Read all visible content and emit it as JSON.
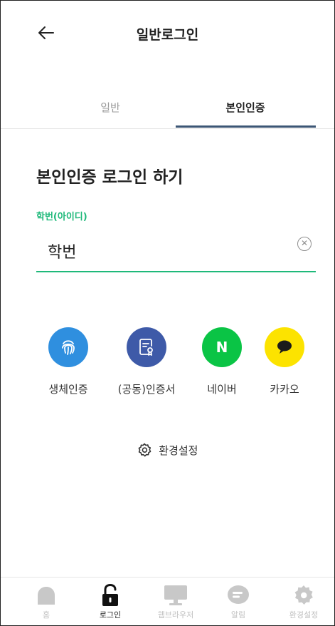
{
  "header": {
    "title": "일반로그인",
    "back_icon": "arrow-left-icon"
  },
  "tabs": [
    {
      "label": "일반",
      "active": false
    },
    {
      "label": "본인인증",
      "active": true
    }
  ],
  "section_title": "본인인증 로그인 하기",
  "student_field": {
    "label": "학번(아이디)",
    "value": "학번",
    "clear_icon": "clear-circle-icon"
  },
  "methods": [
    {
      "label": "생체인증",
      "icon": "fingerprint-icon",
      "color": "#2f8fdf"
    },
    {
      "label": "(공동)인증서",
      "icon": "certificate-icon",
      "color": "#3e5aa8"
    },
    {
      "label": "네이버",
      "icon": "naver-icon",
      "glyph": "N",
      "color": "#0ac445"
    },
    {
      "label": "카카오",
      "icon": "kakao-icon",
      "color": "#fce300"
    }
  ],
  "settings_link": {
    "label": "환경설정",
    "icon": "gear-icon"
  },
  "bottom_nav": [
    {
      "label": "홈",
      "icon": "home-icon",
      "active": false
    },
    {
      "label": "로그인",
      "icon": "unlock-icon",
      "active": true
    },
    {
      "label": "웹브라우저",
      "icon": "monitor-icon",
      "active": false
    },
    {
      "label": "알림",
      "icon": "chat-bubble-icon",
      "active": false
    },
    {
      "label": "환경설정",
      "icon": "gear-icon",
      "active": false
    }
  ],
  "colors": {
    "accent_green": "#1fb97a",
    "tab_indicator": "#3c5675",
    "inactive": "#c0c0c0"
  }
}
